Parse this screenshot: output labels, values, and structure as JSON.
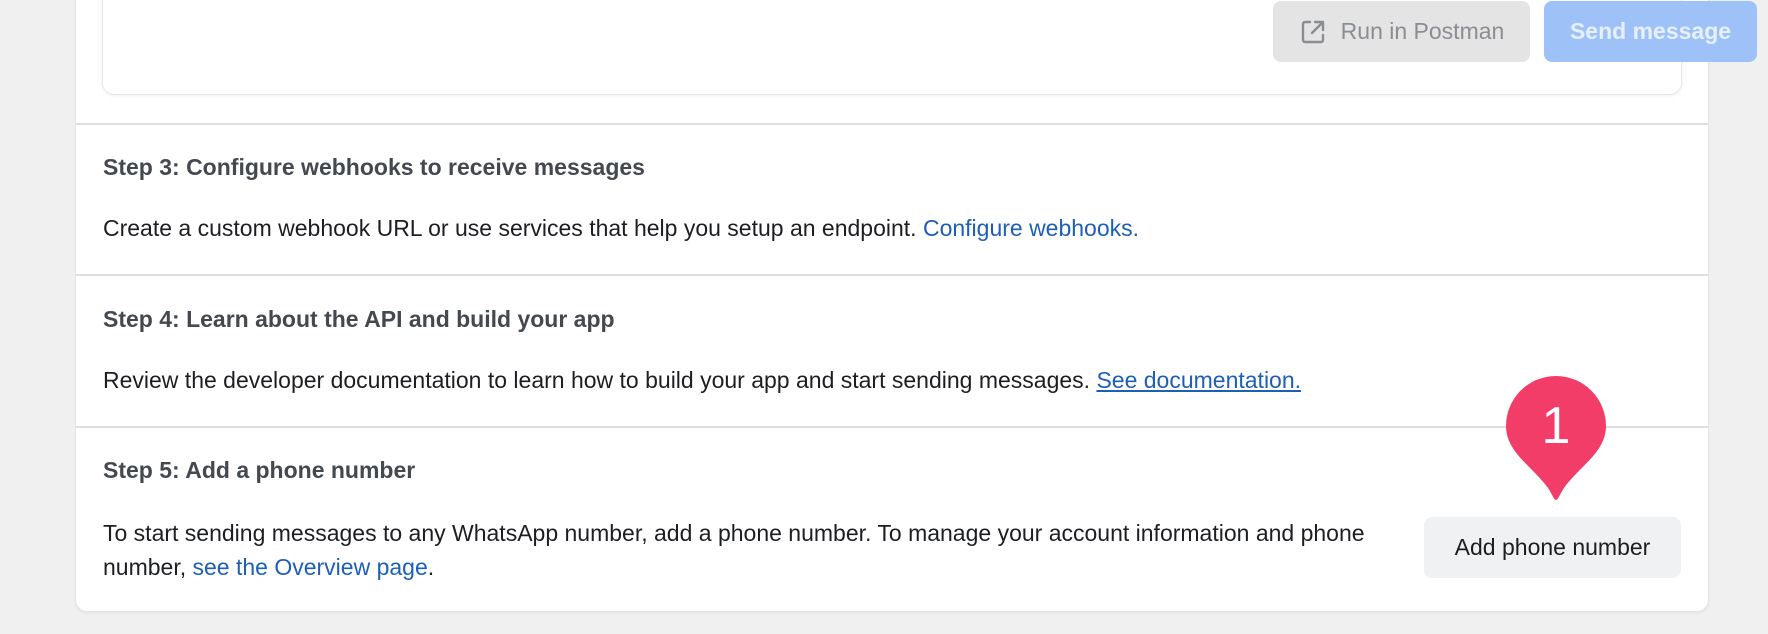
{
  "message_card": {
    "postman_label": "Run in Postman",
    "postman_icon": "external-link-icon",
    "send_label": "Send message"
  },
  "steps": [
    {
      "heading": "Step 3: Configure webhooks to receive messages",
      "text": "Create a custom webhook URL or use services that help you setup an endpoint.",
      "link": "Configure webhooks."
    },
    {
      "heading": "Step 4: Learn about the API and build your app",
      "text": "Review the developer documentation to learn how to build your app and start sending messages.",
      "link": "See documentation."
    },
    {
      "heading": "Step 5: Add a phone number",
      "text": "To start sending messages to any WhatsApp number, add a phone number. To manage your account information and phone number,",
      "link": "see the Overview page",
      "suffix": ".",
      "button_label": "Add phone number"
    }
  ],
  "annotation": {
    "number": "1",
    "color": "#f23d68"
  },
  "colors": {
    "link": "#1d5fb8",
    "send_disabled": "#9ec2f8",
    "postman_bg": "#e4e4e5"
  }
}
